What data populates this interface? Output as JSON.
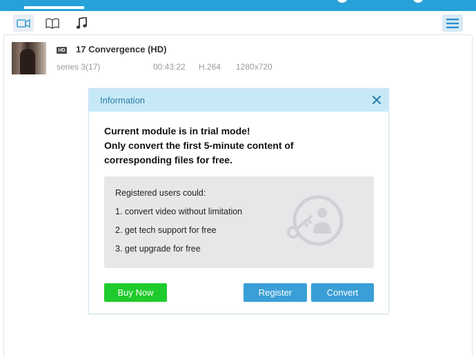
{
  "colors": {
    "accent": "#27a2d9",
    "buy_now": "#1fcb2c",
    "primary_button": "#3a9fd6",
    "dialog_header": "#c7e9f7"
  },
  "toolbar": {
    "items": [
      {
        "icon": "video-icon"
      },
      {
        "icon": "book-icon"
      },
      {
        "icon": "music-icon"
      },
      {
        "icon": "hamburger-menu-icon"
      }
    ]
  },
  "file": {
    "badge": "HD",
    "title": "17 Convergence (HD)",
    "series": "series 3(17)",
    "duration": "00:43:22",
    "codec": "H.264",
    "resolution": "1280x720"
  },
  "dialog": {
    "title": "Information",
    "message_lines": [
      "Current module is in trial mode!",
      "Only convert the first 5-minute content of",
      "corresponding files for free."
    ],
    "benefits_heading": "Registered users could:",
    "benefits": [
      "1. convert video without limitation",
      "2. get tech support for free",
      "3. get upgrade for free"
    ],
    "buttons": {
      "buy_now": "Buy Now",
      "register": "Register",
      "convert": "Convert"
    }
  }
}
